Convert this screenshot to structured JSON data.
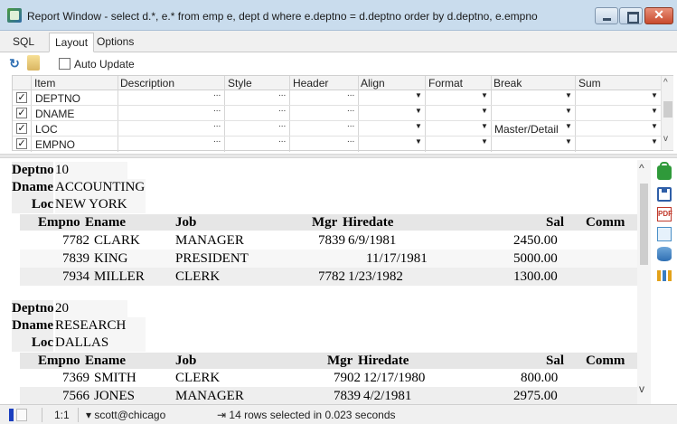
{
  "window": {
    "title": "Report Window - select d.*, e.* from emp e, dept d where e.deptno = d.deptno order by d.deptno, e.empno",
    "close_glyph": "✕"
  },
  "tabs": [
    {
      "label": "SQL"
    },
    {
      "label": "Layout"
    },
    {
      "label": "Options"
    }
  ],
  "toolbar": {
    "refresh_glyph": "↻",
    "auto_update_label": "Auto Update"
  },
  "layout_grid": {
    "headers": [
      "Item",
      "Description",
      "Style",
      "Header",
      "Align",
      "Format",
      "Break",
      "Sum"
    ],
    "rows": [
      {
        "checked": "✓",
        "item": "DEPTNO",
        "break": ""
      },
      {
        "checked": "✓",
        "item": "DNAME",
        "break": ""
      },
      {
        "checked": "✓",
        "item": "LOC",
        "break": "Master/Detail"
      },
      {
        "checked": "✓",
        "item": "EMPNO",
        "break": ""
      }
    ],
    "ellipsis": "...",
    "dropdown_glyph": "▼",
    "scroll_up_glyph": "^",
    "scroll_down_glyph": "v"
  },
  "report": {
    "master_labels": {
      "deptno": "Deptno",
      "dname": "Dname",
      "loc": "Loc"
    },
    "detail_headers": {
      "empno": "Empno",
      "ename": "Ename",
      "job": "Job",
      "mgr": "Mgr",
      "hiredate": "Hiredate",
      "sal": "Sal",
      "comm": "Comm"
    },
    "groups": [
      {
        "deptno": "10",
        "dname": "ACCOUNTING",
        "loc": "NEW YORK",
        "rows": [
          {
            "empno": "7782",
            "ename": "CLARK",
            "job": "MANAGER",
            "mgr": "7839",
            "hiredate": "6/9/1981",
            "sal": "2450.00",
            "comm": ""
          },
          {
            "empno": "7839",
            "ename": "KING",
            "job": "PRESIDENT",
            "mgr": "",
            "hiredate": "11/17/1981",
            "sal": "5000.00",
            "comm": ""
          },
          {
            "empno": "7934",
            "ename": "MILLER",
            "job": "CLERK",
            "mgr": "7782",
            "hiredate": "1/23/1982",
            "sal": "1300.00",
            "comm": ""
          }
        ]
      },
      {
        "deptno": "20",
        "dname": "RESEARCH",
        "loc": "DALLAS",
        "rows": [
          {
            "empno": "7369",
            "ename": "SMITH",
            "job": "CLERK",
            "mgr": "7902",
            "hiredate": "12/17/1980",
            "sal": "800.00",
            "comm": ""
          },
          {
            "empno": "7566",
            "ename": "JONES",
            "job": "MANAGER",
            "mgr": "7839",
            "hiredate": "4/2/1981",
            "sal": "2975.00",
            "comm": ""
          }
        ]
      }
    ],
    "scroll_up_glyph": "^",
    "scroll_down_glyph": "v"
  },
  "side_icons": {
    "pdf_glyph": "PDF"
  },
  "status": {
    "position": "1:1",
    "connection": "▾  scott@chicago",
    "message": "⇥  14 rows selected in 0.023 seconds"
  },
  "colors": {
    "accent": "#2f6fb3",
    "status_mark": "#1b3fbf"
  }
}
